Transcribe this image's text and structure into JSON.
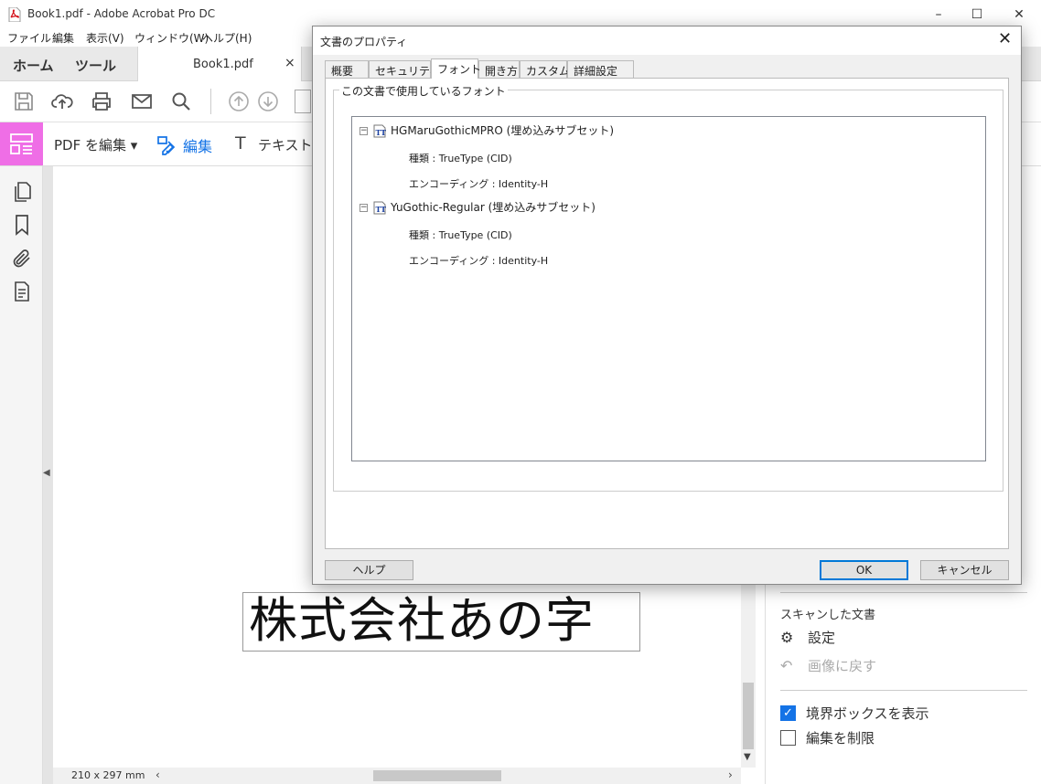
{
  "window": {
    "title": "Book1.pdf - Adobe Acrobat Pro DC",
    "icon": "acrobat-pdf-icon"
  },
  "menu": [
    "ファイル",
    "編集",
    "表示(V)",
    "ウィンドウ(W)",
    "ヘルプ(H)"
  ],
  "tabs": {
    "home": "ホーム",
    "tools": "ツール",
    "document": "Book1.pdf"
  },
  "editbar": {
    "pdf_edit": "PDF を編集 ▾",
    "edit": "編集",
    "text": "テキストを"
  },
  "document": {
    "stamp_text": "株式会社あの字",
    "page_size": "210 x 297 mm"
  },
  "right_pane": {
    "scanned_heading": "スキャンした文書",
    "settings": "設定",
    "revert_image": "画像に戻す",
    "show_bbox": "境界ボックスを表示",
    "show_bbox_checked": true,
    "restrict_edit": "編集を制限",
    "restrict_edit_checked": false
  },
  "dialog": {
    "title": "文書のプロパティ",
    "tabs": [
      "概要",
      "セキュリティ",
      "フォント",
      "開き方",
      "カスタム",
      "詳細設定"
    ],
    "active_tab": "フォント",
    "group_label": "この文書で使用しているフォント",
    "fonts": [
      {
        "name": "HGMaruGothicMPRO (埋め込みサブセット)",
        "type": "種類 : TrueType (CID)",
        "encoding": "エンコーディング : Identity-H"
      },
      {
        "name": "YuGothic-Regular (埋め込みサブセット)",
        "type": "種類 : TrueType (CID)",
        "encoding": "エンコーディング : Identity-H"
      }
    ],
    "help_button": "ヘルプ",
    "ok_button": "OK",
    "cancel_button": "キャンセル"
  },
  "colors": {
    "accent": "#1473e6",
    "edit_tool_pink": "#ef6ee6"
  }
}
